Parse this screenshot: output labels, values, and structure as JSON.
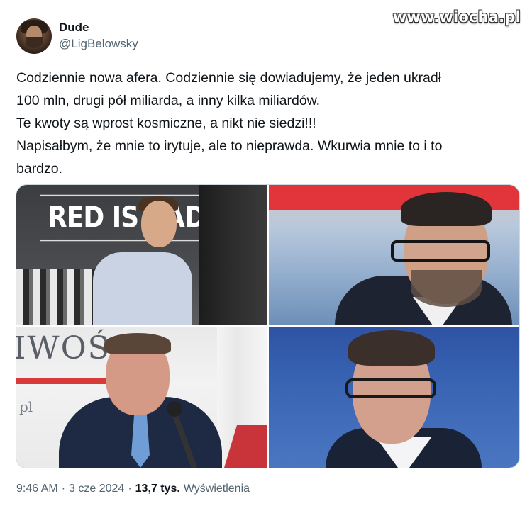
{
  "watermark": "www.wiocha.pl",
  "author": {
    "display_name": "Dude",
    "handle": "@LigBelowsky"
  },
  "tweet": {
    "text": "Codziennie nowa afera. Codziennie się dowiadujemy, że jeden ukradł\n100 mln, drugi pół miliarda, a inny kilka miliardów.\nTe kwoty są wprost kosmiczne, a nikt nie siedzi!!!\nNapisałbym, że mnie to irytuje, ale to nieprawda. Wkurwia mnie to i to\nbardzo."
  },
  "media": {
    "photo1_sign": "RED IS BAD",
    "photo3_sign_word": "IWOŚ",
    "photo3_sign_small": "pl"
  },
  "meta": {
    "time": "9:46 AM",
    "sep1": "·",
    "date": "3 cze 2024",
    "sep2": "·",
    "views_count": "13,7 tys.",
    "views_label": "Wyświetlenia"
  }
}
